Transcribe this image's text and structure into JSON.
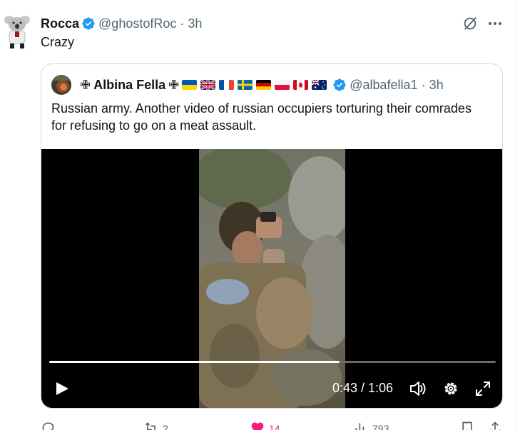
{
  "tweet": {
    "author_name": "Rocca",
    "handle": "@ghostofRoc",
    "time": "3h",
    "text": "Crazy"
  },
  "quote": {
    "author_name": "Albina Fella",
    "cross_left": "✙",
    "cross_right": "✙",
    "flags": [
      "ukraine-flag",
      "uk-flag",
      "france-flag",
      "sweden-flag",
      "germany-flag",
      "poland-flag",
      "canada-flag",
      "australia-flag"
    ],
    "handle": "@albafella1",
    "time": "3h",
    "text": "Russian army. Another video of russian occupiers torturing their comrades for refusing to go on a meat assault."
  },
  "video": {
    "time_display": "0:43 / 1:06",
    "progress_fraction": 0.65
  },
  "actions": {
    "replies": "",
    "reposts": "2",
    "likes": "14",
    "views": "793"
  },
  "colors": {
    "accent": "#1d9bf0",
    "like": "#f91880",
    "muted": "#536471",
    "border": "#cfd9de"
  }
}
